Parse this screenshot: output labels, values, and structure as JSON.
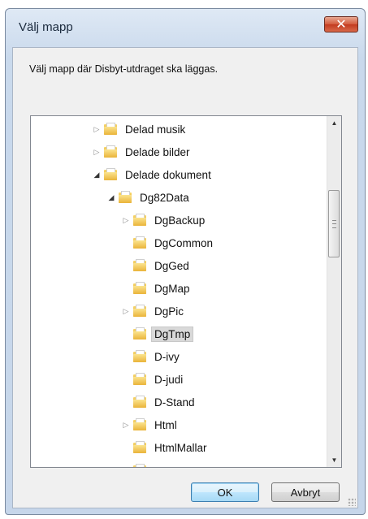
{
  "window": {
    "title": "Välj mapp",
    "close_label": "✕"
  },
  "message": "Välj mapp där Disbyt-utdraget ska läggas.",
  "tree": {
    "items": [
      {
        "label": "Delad musik",
        "expander": "collapsed"
      },
      {
        "label": "Delade bilder",
        "expander": "collapsed"
      },
      {
        "label": "Delade dokument",
        "expander": "expanded"
      },
      {
        "label": "Dg82Data",
        "expander": "expanded"
      },
      {
        "label": "DgBackup",
        "expander": "collapsed"
      },
      {
        "label": "DgCommon",
        "expander": "none"
      },
      {
        "label": "DgGed",
        "expander": "none"
      },
      {
        "label": "DgMap",
        "expander": "none"
      },
      {
        "label": "DgPic",
        "expander": "collapsed"
      },
      {
        "label": "DgTmp",
        "expander": "none",
        "selected": true
      },
      {
        "label": "D-ivy",
        "expander": "none"
      },
      {
        "label": "D-judi",
        "expander": "none"
      },
      {
        "label": "D-Stand",
        "expander": "none"
      },
      {
        "label": "Html",
        "expander": "collapsed"
      },
      {
        "label": "HtmlMallar",
        "expander": "none"
      }
    ],
    "selected": "DgTmp"
  },
  "icons": {
    "folder": "folder-icon",
    "collapsed": "triangle-right-icon",
    "expanded": "triangle-down-icon"
  },
  "buttons": {
    "ok": "OK",
    "cancel": "Avbryt"
  },
  "colors": {
    "close_button": "#c23b1f",
    "selection": "#d9d9d9",
    "default_button_border": "#3c7fb1"
  }
}
